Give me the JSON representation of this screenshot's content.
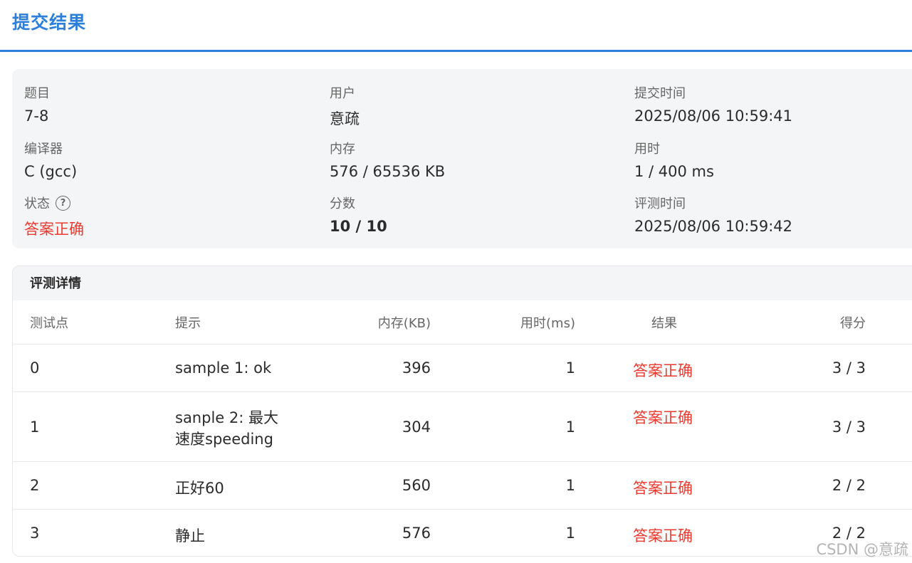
{
  "header": {
    "title": "提交结果"
  },
  "summary": {
    "problem": {
      "label": "题目",
      "value": "7-8"
    },
    "user": {
      "label": "用户",
      "value": "意疏"
    },
    "submit_time": {
      "label": "提交时间",
      "value": "2025/08/06 10:59:41"
    },
    "compiler": {
      "label": "编译器",
      "value": "C (gcc)"
    },
    "memory": {
      "label": "内存",
      "value": "576 / 65536 KB"
    },
    "time_used": {
      "label": "用时",
      "value": "1 / 400 ms"
    },
    "status": {
      "label": "状态",
      "help_icon": "?",
      "value": "答案正确"
    },
    "score": {
      "label": "分数",
      "value": "10 / 10"
    },
    "judge_time": {
      "label": "评测时间",
      "value": "2025/08/06 10:59:42"
    }
  },
  "details": {
    "title": "评测详情",
    "columns": [
      "测试点",
      "提示",
      "内存(KB)",
      "用时(ms)",
      "结果",
      "得分"
    ],
    "rows": [
      {
        "case": "0",
        "hint": "sample 1: ok",
        "memory": "396",
        "time": "1",
        "result": "答案正确",
        "score": "3 / 3"
      },
      {
        "case": "1",
        "hint_line1": "sanple 2: 最大",
        "hint_line2": "速度speeding",
        "memory": "304",
        "time": "1",
        "result": "答案正确",
        "score": "3 / 3"
      },
      {
        "case": "2",
        "hint": "正好60",
        "memory": "560",
        "time": "1",
        "result": "答案正确",
        "score": "2 / 2"
      },
      {
        "case": "3",
        "hint": "静止",
        "memory": "576",
        "time": "1",
        "result": "答案正确",
        "score": "2 / 2"
      }
    ]
  },
  "watermark": "CSDN @意疏",
  "colors": {
    "accent": "#2d7fd9",
    "success_text": "#ea3a2f",
    "panel_bg": "#f4f5f7"
  }
}
